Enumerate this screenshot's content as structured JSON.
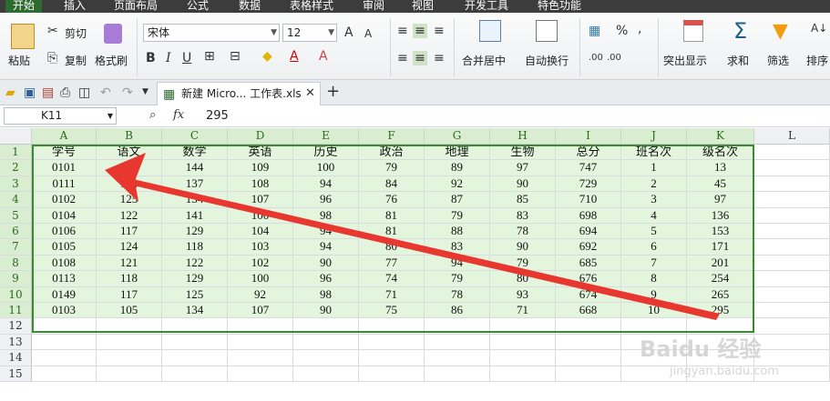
{
  "menu": {
    "tabs": [
      "开始",
      "插入",
      "页面布局",
      "公式",
      "数据",
      "表格样式",
      "审阅",
      "视图",
      "开发工具",
      "特色功能"
    ],
    "active": 0
  },
  "ribbon": {
    "paste": "粘贴",
    "cut": "剪切",
    "copy": "复制",
    "format_painter": "格式刷",
    "font_name": "宋体",
    "font_size": "12",
    "merge_center": "合并居中",
    "wrap_text": "自动换行",
    "highlight": "突出显示",
    "sum": "求和",
    "filter": "筛选",
    "sort": "排序"
  },
  "document": {
    "tab_title": "新建 Micro... 工作表.xls"
  },
  "formula_bar": {
    "name_box": "K11",
    "fx": "fx",
    "value": "295"
  },
  "sheet": {
    "columns": [
      "A",
      "B",
      "C",
      "D",
      "E",
      "F",
      "G",
      "H",
      "I",
      "J",
      "K",
      "L"
    ],
    "rows": [
      "1",
      "2",
      "3",
      "4",
      "5",
      "6",
      "7",
      "8",
      "9",
      "10",
      "11",
      "12",
      "13",
      "14",
      "15"
    ],
    "header": [
      "学号",
      "语文",
      "数学",
      "英语",
      "历史",
      "政治",
      "地理",
      "生物",
      "总分",
      "班名次",
      "级名次"
    ],
    "data": [
      [
        "0101",
        "129",
        "144",
        "109",
        "100",
        "79",
        "89",
        "97",
        "747",
        "1",
        "13"
      ],
      [
        "0111",
        "124",
        "137",
        "108",
        "94",
        "84",
        "92",
        "90",
        "729",
        "2",
        "45"
      ],
      [
        "0102",
        "125",
        "134",
        "107",
        "96",
        "76",
        "87",
        "85",
        "710",
        "3",
        "97"
      ],
      [
        "0104",
        "122",
        "141",
        "100",
        "98",
        "81",
        "79",
        "83",
        "698",
        "4",
        "136"
      ],
      [
        "0106",
        "117",
        "129",
        "104",
        "94",
        "81",
        "88",
        "78",
        "694",
        "5",
        "153"
      ],
      [
        "0105",
        "124",
        "118",
        "103",
        "94",
        "80",
        "83",
        "90",
        "692",
        "6",
        "171"
      ],
      [
        "0108",
        "121",
        "122",
        "102",
        "90",
        "77",
        "94",
        "79",
        "685",
        "7",
        "201"
      ],
      [
        "0113",
        "118",
        "129",
        "100",
        "96",
        "74",
        "79",
        "80",
        "676",
        "8",
        "254"
      ],
      [
        "0149",
        "117",
        "125",
        "92",
        "98",
        "71",
        "78",
        "93",
        "674",
        "9",
        "265"
      ],
      [
        "0103",
        "105",
        "134",
        "107",
        "90",
        "75",
        "86",
        "71",
        "668",
        "10",
        "295"
      ]
    ]
  },
  "colors": {
    "accent": "#2f6b30",
    "arrow": "#e8372f",
    "highlight": "#e3f5dc"
  },
  "watermark": {
    "brand": "Baidu 经验",
    "url": "jingyan.baidu.com"
  }
}
